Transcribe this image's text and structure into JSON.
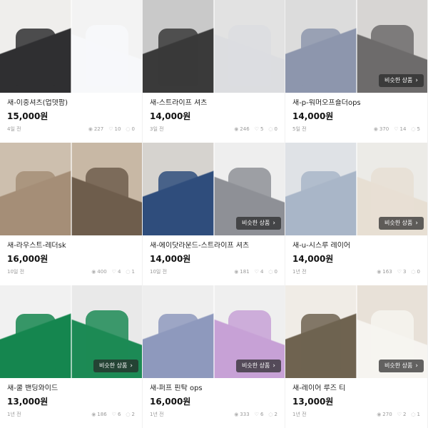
{
  "button_label": "비슷한 상품",
  "chevron": "›",
  "icons": {
    "views": "eye-icon",
    "likes": "heart-icon",
    "chats": "chat-bubble-icon"
  },
  "products": [
    {
      "title": "새-이중셔츠(업뎃팜)",
      "price": "15,000원",
      "time": "4일 전",
      "views": "227",
      "likes": "10",
      "chats": "0",
      "left_colors": [
        "#efeeec",
        "#2f2f31"
      ],
      "right_colors": [
        "#f3f3f3",
        "#f7f8fa"
      ],
      "similar": false
    },
    {
      "title": "새-스트라이프 셔츠",
      "price": "14,000원",
      "time": "3일 전",
      "views": "246",
      "likes": "5",
      "chats": "0",
      "left_colors": [
        "#c9c9c9",
        "#3a3a3a"
      ],
      "right_colors": [
        "#e2e2e2",
        "#dcdde0"
      ],
      "similar": false
    },
    {
      "title": "새-p-워머오프숄더ops",
      "price": "14,000원",
      "time": "5일 전",
      "views": "370",
      "likes": "14",
      "chats": "5",
      "left_colors": [
        "#dcdcdc",
        "#8d96ad"
      ],
      "right_colors": [
        "#d7d5d3",
        "#6d6b6b"
      ],
      "similar": true
    },
    {
      "title": "새-라우스트-레더sk",
      "price": "16,000원",
      "time": "10일 전",
      "views": "400",
      "likes": "4",
      "chats": "1",
      "left_colors": [
        "#cdbfae",
        "#a58e77"
      ],
      "right_colors": [
        "#c8b8a5",
        "#6e5d4c"
      ],
      "similar": false
    },
    {
      "title": "새-에이닷라운드-스트라이프 셔츠",
      "price": "14,000원",
      "time": "10일 전",
      "views": "181",
      "likes": "4",
      "chats": "0",
      "left_colors": [
        "#d6d3cf",
        "#2f4d7c"
      ],
      "right_colors": [
        "#eeeeee",
        "#8e9096"
      ],
      "similar": true
    },
    {
      "title": "새-u-시스루 레이어",
      "price": "14,000원",
      "time": "1년 전",
      "views": "163",
      "likes": "3",
      "chats": "0",
      "left_colors": [
        "#dfe2e6",
        "#a9b6c8"
      ],
      "right_colors": [
        "#ecebe7",
        "#e7dfd3"
      ],
      "similar": true
    },
    {
      "title": "새-쿨 밴딩와이드",
      "price": "13,000원",
      "time": "1년 전",
      "views": "186",
      "likes": "6",
      "chats": "2",
      "left_colors": [
        "#f1f1f1",
        "#15864f"
      ],
      "right_colors": [
        "#e9e9e9",
        "#1c8a55"
      ],
      "similar": true
    },
    {
      "title": "새-퍼프 핀탁 ops",
      "price": "16,000원",
      "time": "1년 전",
      "views": "333",
      "likes": "6",
      "chats": "2",
      "left_colors": [
        "#eeeeee",
        "#8e99bd"
      ],
      "right_colors": [
        "#efefef",
        "#c7a1d6"
      ],
      "similar": true
    },
    {
      "title": "새-레이어 루즈 티",
      "price": "13,000원",
      "time": "1년 전",
      "views": "270",
      "likes": "2",
      "chats": "1",
      "left_colors": [
        "#f0ece6",
        "#6f6350"
      ],
      "right_colors": [
        "#e8e1d8",
        "#f6f4f0"
      ],
      "similar": true
    }
  ]
}
